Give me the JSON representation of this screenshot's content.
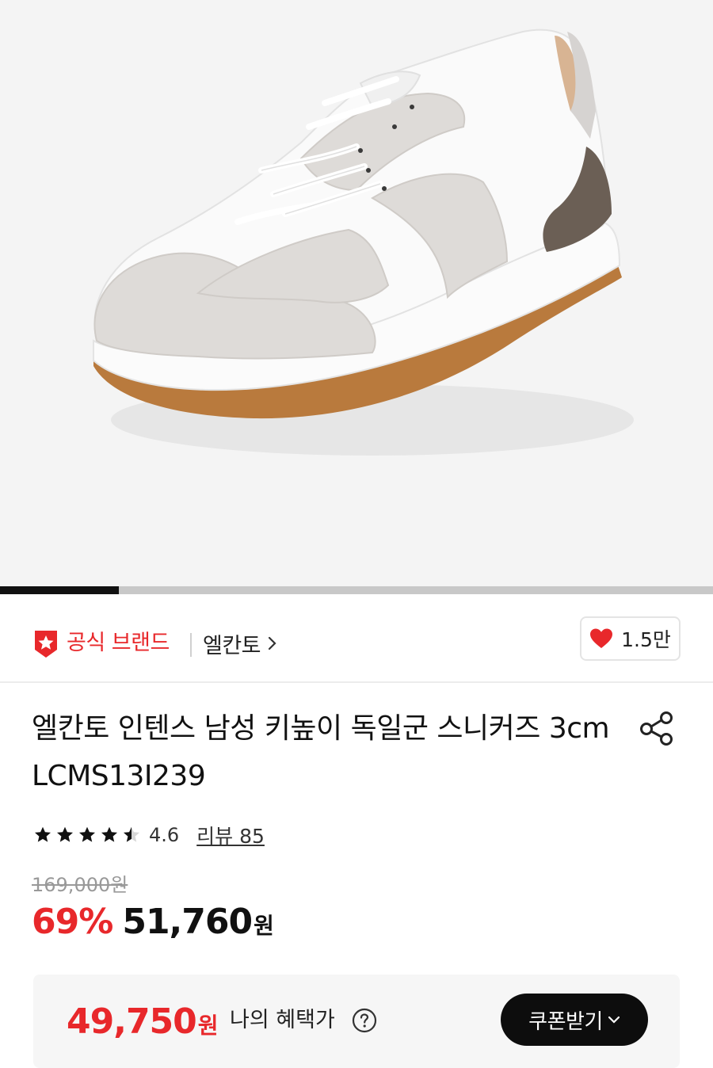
{
  "gallery": {
    "image_alt": "white and light grey sneaker with gum sole",
    "slide_progress": 0.167
  },
  "brand": {
    "official_label": "공식 브랜드",
    "name": "엘칸토"
  },
  "like": {
    "count": "1.5만"
  },
  "product": {
    "title": "엘칸토 인텐스 남성 키높이 독일군 스니커즈 3cm LCMS13I239"
  },
  "rating": {
    "score": 4.6,
    "score_text": "4.6",
    "stars_filled": 4.5,
    "review_text": "리뷰 85"
  },
  "price": {
    "original": "169,000원",
    "discount": "69%",
    "sale": "51,760",
    "sale_unit": "원"
  },
  "benefit": {
    "amount": "49,750",
    "unit": "원",
    "label": "나의 혜택가",
    "coupon_label": "쿠폰받기"
  },
  "colors": {
    "accent": "#e8282b",
    "dark": "#0d0d0d"
  }
}
